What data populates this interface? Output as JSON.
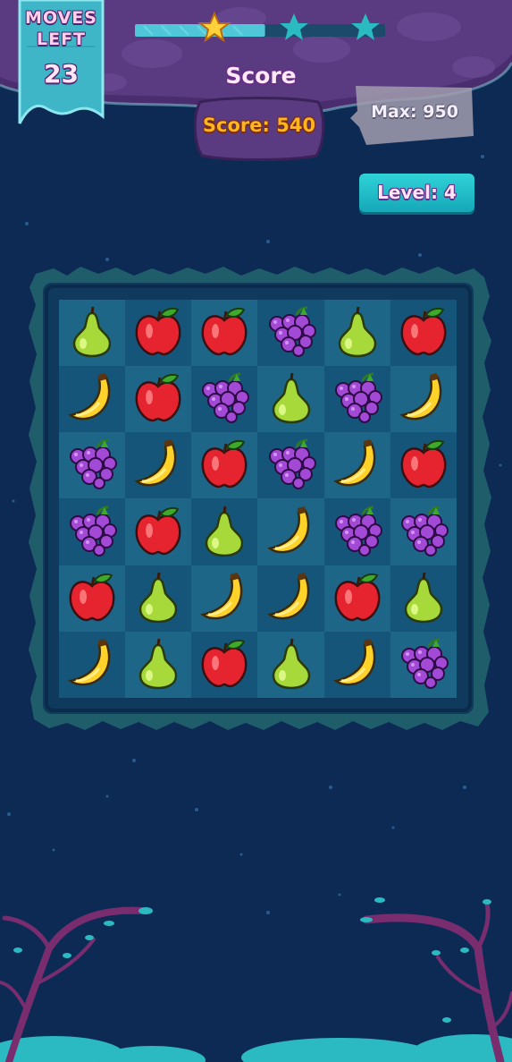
{
  "hud": {
    "moves_title": "MOVES\nLEFT",
    "moves_value": "23",
    "score_label": "Score",
    "score_text": "Score: 540",
    "max_text": "Max: 950",
    "level_text": "Level: 4",
    "progress_fraction": 0.52,
    "stars_earned": 1,
    "stars_total": 3
  },
  "board": {
    "rows": 6,
    "cols": 6,
    "tiles": [
      [
        "pear",
        "apple",
        "apple",
        "grapes",
        "pear",
        "apple"
      ],
      [
        "banana",
        "apple",
        "grapes",
        "pear",
        "grapes",
        "banana"
      ],
      [
        "grapes",
        "banana",
        "apple",
        "grapes",
        "banana",
        "apple"
      ],
      [
        "grapes",
        "apple",
        "pear",
        "banana",
        "grapes",
        "grapes"
      ],
      [
        "apple",
        "pear",
        "banana",
        "banana",
        "apple",
        "pear"
      ],
      [
        "banana",
        "pear",
        "apple",
        "pear",
        "banana",
        "grapes"
      ]
    ]
  },
  "colors": {
    "background": "#0d2a55",
    "board_light": "#1e6688",
    "board_dark": "#16557a",
    "frame_grass": "#1f5d6a",
    "rock": "#4a2d6e",
    "banner": "#3fb6c8",
    "score_orange": "#ffb51e",
    "level_button": "#22c3cf"
  }
}
